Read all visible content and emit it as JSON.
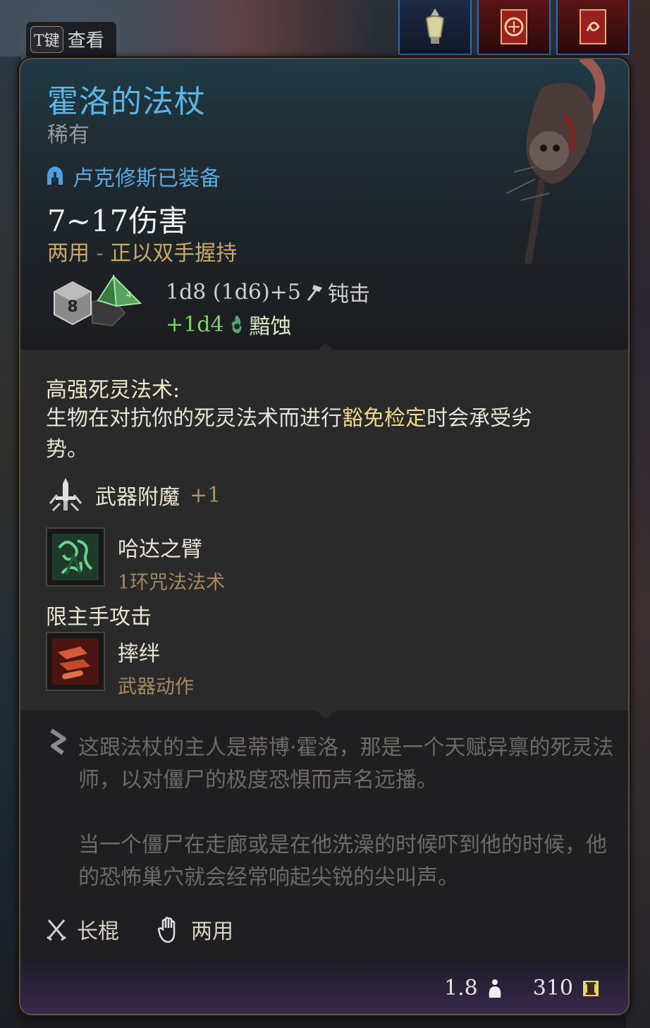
{
  "hint": {
    "key": "T键",
    "label": "查看"
  },
  "item": {
    "name": "霍洛的法杖",
    "rarity": "稀有",
    "equipped_by": "卢克修斯已装备",
    "damage_range": "7~17伤害",
    "handedness": "两用",
    "handedness_sep": " - ",
    "handedness_note": "正以双手握持",
    "damage_primary": "1d8 (1d6)+5",
    "damage_primary_type": "钝击",
    "damage_bonus": "+1d4",
    "damage_bonus_type": "黯蚀"
  },
  "ability": {
    "title": "高强死灵法术:",
    "desc_before": "生物在对抗你的死灵法术而进行",
    "desc_highlight": "豁免检定",
    "desc_after": "时会承受劣势。"
  },
  "enchantment": {
    "label": "武器附魔",
    "bonus": "+1"
  },
  "spells": [
    {
      "name": "哈达之臂",
      "sub": "1环咒法法术"
    }
  ],
  "offhand_label": "限主手攻击",
  "actions": [
    {
      "name": "摔绊",
      "sub": "武器动作"
    }
  ],
  "flavor": [
    "这跟法杖的主人是蒂博·霍洛，那是一个天赋异禀的死灵法师，以对僵尸的极度恐惧而声名远播。",
    "当一个僵尸在走廊或是在他洗澡的时候吓到他的时候，他的恐怖巢穴就会经常响起尖锐的尖叫声。"
  ],
  "properties": {
    "weapon_type": "长棍",
    "hands": "两用"
  },
  "footer": {
    "weight": "1.8",
    "value": "310"
  },
  "colors": {
    "title": "#5bb6e6",
    "equipped": "#5aa8e0",
    "handedness": "#c9a868",
    "bonus_damage": "#7ed36a",
    "highlight": "#f2d98a",
    "flavor": "#6e6a66",
    "border": "#5e5040"
  },
  "icons": {
    "equipped": "helmet-icon",
    "dice": "dice-icon",
    "blunt": "hammer-icon",
    "necrotic": "necrotic-flame-icon",
    "enchant": "sword-enchant-icon",
    "spell": "arms-of-hadar-icon",
    "action": "topple-icon",
    "flavor": "quill-icon",
    "weapon_type": "crossed-swords-icon",
    "hands": "hand-icon",
    "weight": "weight-icon",
    "value": "gold-coin-icon"
  }
}
